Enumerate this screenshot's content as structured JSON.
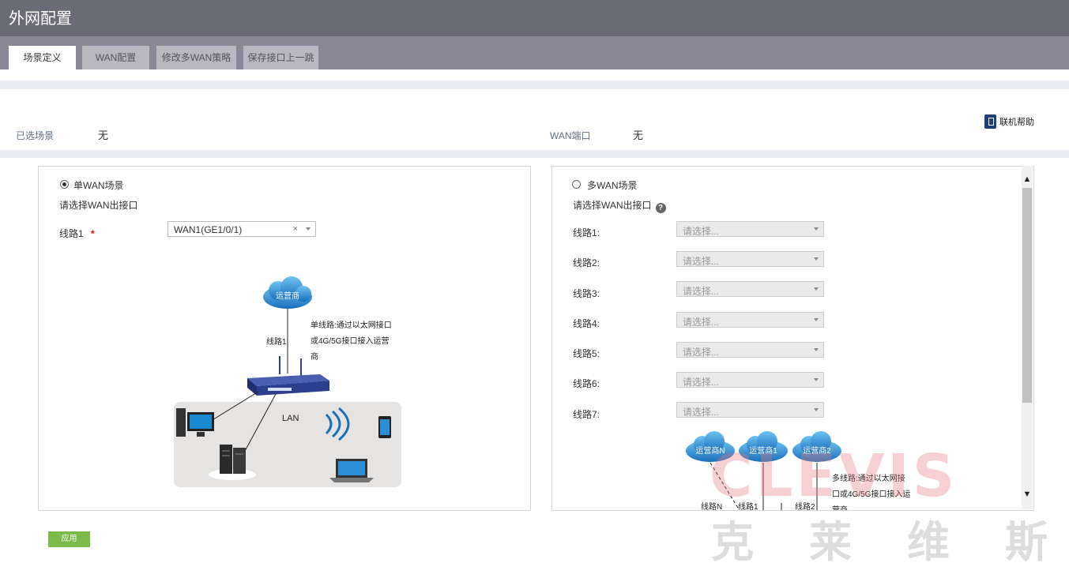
{
  "window": {
    "title": "外网配置"
  },
  "tabs": [
    {
      "label": "场景定义",
      "active": true
    },
    {
      "label": "WAN配置",
      "active": false
    },
    {
      "label": "修改多WAN策略",
      "active": false
    },
    {
      "label": "保存接口上一跳",
      "active": false
    }
  ],
  "info": {
    "selected_scene_label": "已选场景",
    "selected_scene_value": "无",
    "wan_port_label": "WAN端口",
    "wan_port_value": "无",
    "help_label": "联机帮助"
  },
  "single_wan": {
    "radio_label": "单WAN场景",
    "selected": true,
    "prompt": "请选择WAN出接口",
    "line_label": "线路1",
    "required_mark": "*",
    "line_value": "WAN1(GE1/0/1)",
    "clear_symbol": "×",
    "diagram": {
      "isp_label": "运营商",
      "line_label": "线路1",
      "desc_lines": [
        "单线路:通过以太网接口",
        "或4G/5G接口接入运营",
        "商"
      ],
      "lan_label": "LAN"
    }
  },
  "multi_wan": {
    "radio_label": "多WAN场景",
    "selected": false,
    "prompt": "请选择WAN出接口",
    "help_symbol": "?",
    "placeholder": "请选择...",
    "lines": [
      {
        "label": "线路1:"
      },
      {
        "label": "线路2:"
      },
      {
        "label": "线路3:"
      },
      {
        "label": "线路4:"
      },
      {
        "label": "线路5:"
      },
      {
        "label": "线路6:"
      },
      {
        "label": "线路7:"
      }
    ],
    "diagram": {
      "isp_n": "运营商N",
      "isp_1": "运营商1",
      "isp_2": "运营商2",
      "desc_lines": [
        "多线路:通过以太网接",
        "口或4G/5G接口接入运",
        "营商"
      ],
      "line_n": "线路N",
      "line_1": "线路1",
      "line_2": "线路2"
    }
  },
  "apply_label": "应用",
  "watermark": {
    "brand": "CLEVIS",
    "chinese": "克莱维斯"
  },
  "colors": {
    "titlebar": "#6b6b78",
    "tabbar": "#8a8896",
    "apply": "#7cbb4a",
    "cloud": "#2a8fd6",
    "router": "#2c3f8f"
  }
}
